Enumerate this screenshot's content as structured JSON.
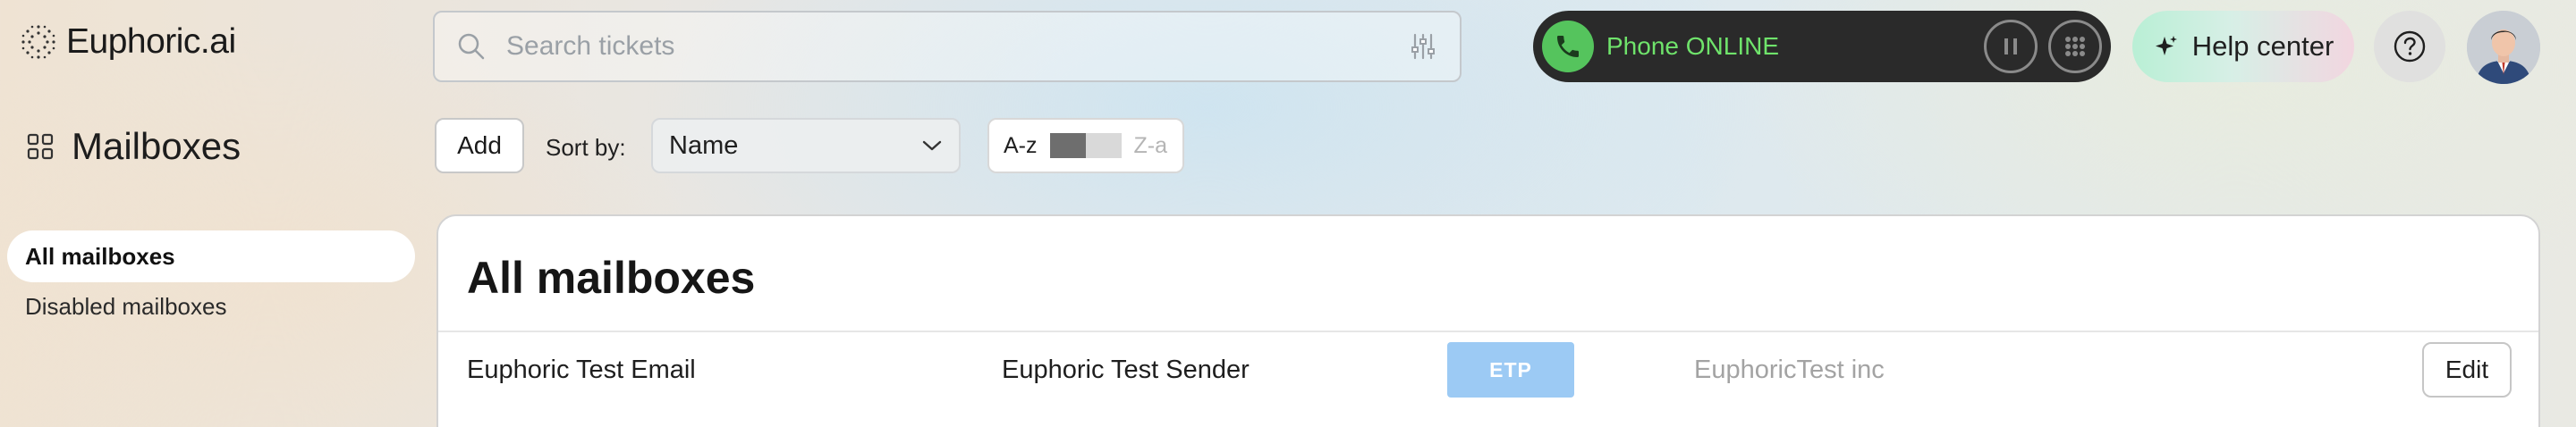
{
  "header": {
    "logo_text": "Euphoric.ai",
    "search": {
      "placeholder": "Search tickets",
      "value": ""
    },
    "phone": {
      "status_label": "Phone ONLINE",
      "status_color": "#6fe36b"
    },
    "help_label": "Help center",
    "icons": [
      "logo-dots-icon",
      "search-icon",
      "filter-sliders-icon",
      "phone-icon",
      "pause-icon",
      "dialpad-icon",
      "sparkle-icon",
      "help-question-icon",
      "user-avatar"
    ]
  },
  "sidebar": {
    "title": "Mailboxes",
    "items": [
      {
        "label": "All mailboxes",
        "active": true
      },
      {
        "label": "Disabled mailboxes",
        "active": false
      }
    ]
  },
  "toolbar": {
    "add_label": "Add",
    "sort_label": "Sort by:",
    "sort_value": "Name",
    "order_asc_label": "A-z",
    "order_desc_label": "Z-a"
  },
  "main": {
    "title": "All mailboxes",
    "rows": [
      {
        "name": "Euphoric Test Email",
        "sender": "Euphoric Test Sender",
        "badge": "ETP",
        "company": "EuphoricTest inc",
        "edit_label": "Edit"
      }
    ]
  },
  "colors": {
    "accent_green": "#55c45d",
    "badge_blue": "#9ccaf4",
    "phone_bg": "#2a2a2a"
  }
}
